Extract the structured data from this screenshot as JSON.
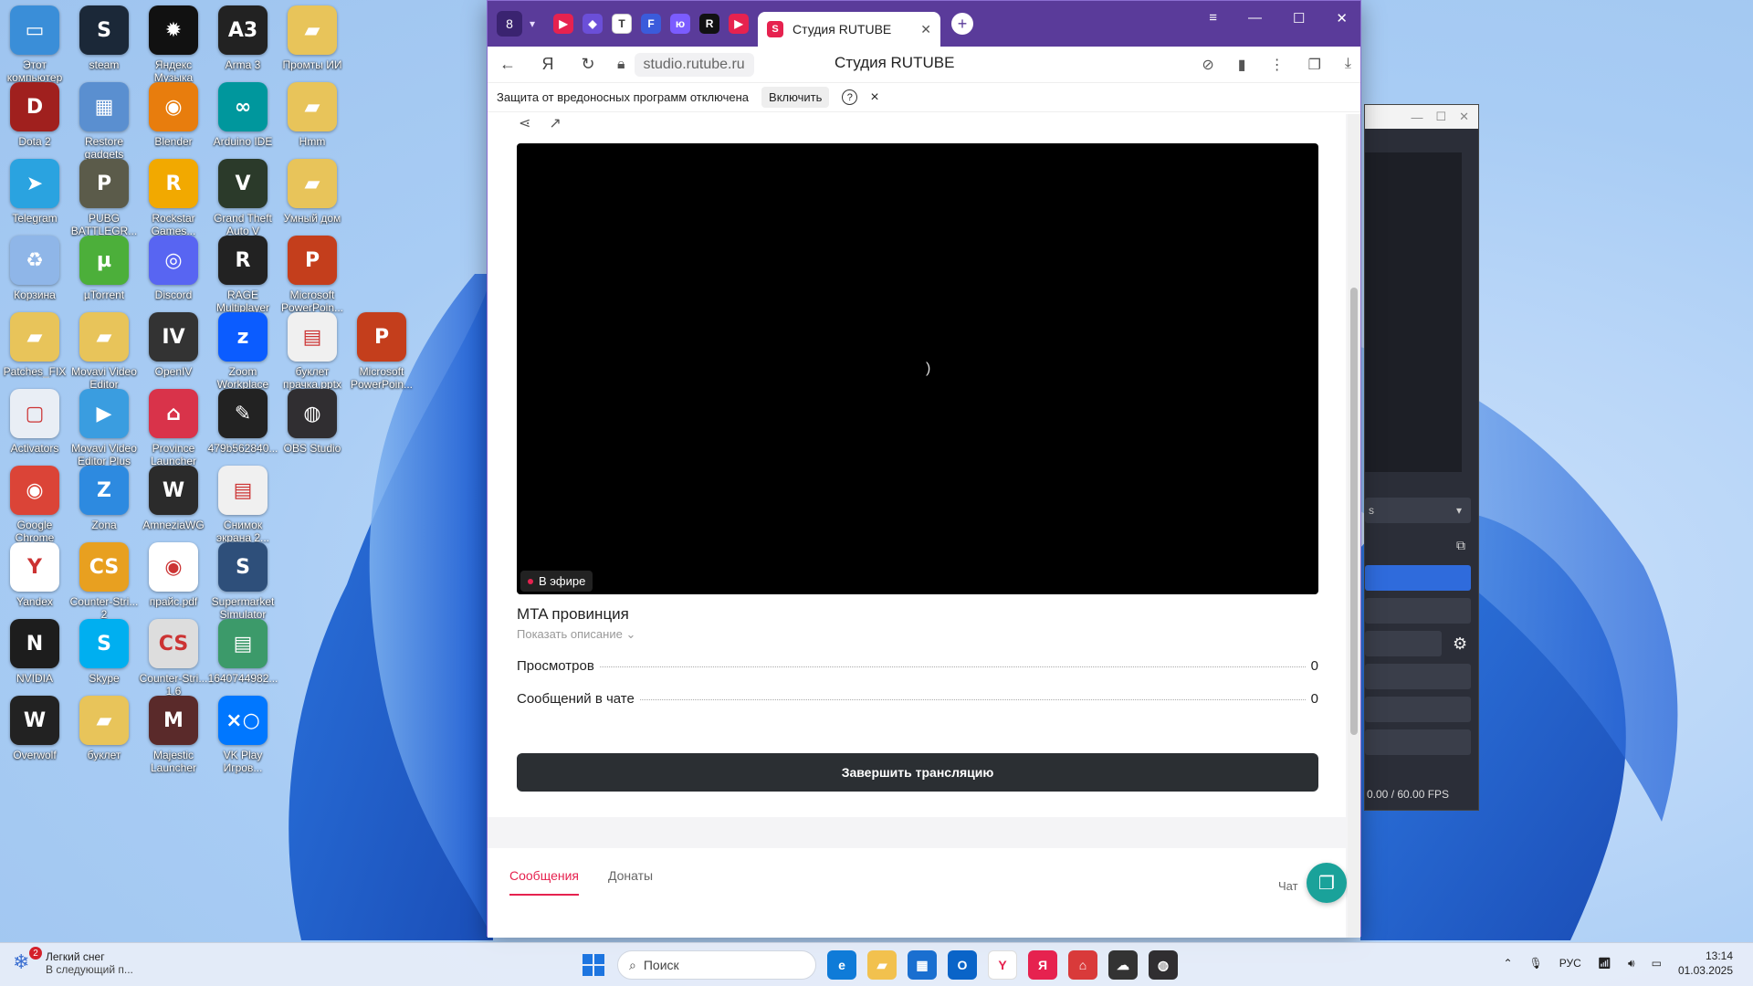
{
  "desktop": {
    "icons": [
      {
        "label": "Этот компьютер",
        "color": "#3a8ed8",
        "glyph": "▭"
      },
      {
        "label": "steam",
        "color": "#1b2838",
        "glyph": "S"
      },
      {
        "label": "Яндекс Музыка",
        "color": "#111111",
        "glyph": "✹"
      },
      {
        "label": "Arma 3",
        "color": "#222222",
        "glyph": "A3"
      },
      {
        "label": "Промты ИИ",
        "color": "#e8c45a",
        "glyph": "▰"
      },
      {
        "label": "Dota 2",
        "color": "#a0201e",
        "glyph": "D"
      },
      {
        "label": "Restore gadgets",
        "color": "#5a8fd0",
        "glyph": "▦"
      },
      {
        "label": "Blender",
        "color": "#e87d0d",
        "glyph": "◉"
      },
      {
        "label": "Arduino IDE",
        "color": "#00979d",
        "glyph": "∞"
      },
      {
        "label": "Hmm",
        "color": "#e8c45a",
        "glyph": "▰"
      },
      {
        "label": "Telegram",
        "color": "#2aa3e0",
        "glyph": "➤"
      },
      {
        "label": "PUBG BATTLEGR...",
        "color": "#5b5b4a",
        "glyph": "P"
      },
      {
        "label": "Rockstar Games...",
        "color": "#f2a900",
        "glyph": "R"
      },
      {
        "label": "Grand Theft Auto V",
        "color": "#2b3a2a",
        "glyph": "V"
      },
      {
        "label": "Умный дом",
        "color": "#e8c45a",
        "glyph": "▰"
      },
      {
        "label": "Корзина",
        "color": "#8fb6e8",
        "glyph": "♻"
      },
      {
        "label": "µTorrent",
        "color": "#4caf3a",
        "glyph": "µ"
      },
      {
        "label": "Discord",
        "color": "#5865f2",
        "glyph": "◎"
      },
      {
        "label": "RAGE Multiplayer",
        "color": "#222222",
        "glyph": "R"
      },
      {
        "label": "Microsoft PowerPoin...",
        "color": "#c43e1c",
        "glyph": "P"
      },
      {
        "label": "Patches_FIX",
        "color": "#e8c45a",
        "glyph": "▰"
      },
      {
        "label": "Movavi Video Editor",
        "color": "#e8c45a",
        "glyph": "▰"
      },
      {
        "label": "OpenIV",
        "color": "#333333",
        "glyph": "IV"
      },
      {
        "label": "Zoom Workplace",
        "color": "#0b5cff",
        "glyph": "z"
      },
      {
        "label": "буклет прачка.pptx",
        "color": "#f0f0f0",
        "glyph": "▤"
      },
      {
        "label": "Microsoft PowerPoin...",
        "color": "#c43e1c",
        "glyph": "P"
      },
      {
        "label": "Activators",
        "color": "#e9eef5",
        "glyph": "▢"
      },
      {
        "label": "Movavi Video Editor Plus",
        "color": "#3a9de0",
        "glyph": "▶"
      },
      {
        "label": "Province Launcher",
        "color": "#d9334a",
        "glyph": "⌂"
      },
      {
        "label": "479b562840...",
        "color": "#222222",
        "glyph": "✎"
      },
      {
        "label": "OBS Studio",
        "color": "#302e31",
        "glyph": "◍"
      },
      {
        "label": "Google Chrome",
        "color": "#db4437",
        "glyph": "◉"
      },
      {
        "label": "Zona",
        "color": "#2d8ae0",
        "glyph": "Z"
      },
      {
        "label": "AmneziaWG",
        "color": "#2b2b2b",
        "glyph": "W"
      },
      {
        "label": "Снимок экрана 2...",
        "color": "#f0f0f0",
        "glyph": "▤"
      },
      {
        "label": "Yandex",
        "color": "#ffffff",
        "glyph": "Y"
      },
      {
        "label": "Counter-Stri... 2",
        "color": "#e8a020",
        "glyph": "CS"
      },
      {
        "label": "прайс.pdf",
        "color": "#ffffff",
        "glyph": "◉"
      },
      {
        "label": "Supermarket Simulator",
        "color": "#2e4f7a",
        "glyph": "S"
      },
      {
        "label": "NVIDIA",
        "color": "#1d1d1d",
        "glyph": "N"
      },
      {
        "label": "Skype",
        "color": "#00aff0",
        "glyph": "S"
      },
      {
        "label": "Counter-Stri... 1.6",
        "color": "#dddddd",
        "glyph": "CS"
      },
      {
        "label": "1640744982...",
        "color": "#3c9a6a",
        "glyph": "▤"
      },
      {
        "label": "Overwolf",
        "color": "#222222",
        "glyph": "W"
      },
      {
        "label": "буклет",
        "color": "#e8c45a",
        "glyph": "▰"
      },
      {
        "label": "Majestic Launcher",
        "color": "#5a2a2a",
        "glyph": "M"
      },
      {
        "label": "VK Play Игров...",
        "color": "#0077ff",
        "glyph": "×○"
      }
    ]
  },
  "obs": {
    "select_text": "s",
    "fps_text": "0.00 / 60.00 FPS"
  },
  "browser": {
    "workspace_count": "8",
    "tab_title": "Студия RUTUBE",
    "url": "studio.rutube.ru",
    "page_title": "Студия RUTUBE",
    "warning_text": "Защита от вредоносных программ отключена",
    "enable_label": "Включить",
    "help_glyph": "?",
    "close_glyph": "×"
  },
  "stream": {
    "live_label": "В эфире",
    "title": "MTA провинция",
    "show_description": "Показать описание",
    "stats": [
      {
        "label": "Просмотров",
        "value": "0"
      },
      {
        "label": "Сообщений в чате",
        "value": "0"
      }
    ],
    "end_button": "Завершить трансляцию"
  },
  "chat": {
    "tabs": [
      "Сообщения",
      "Донаты"
    ],
    "selected_tab": "Сообщения",
    "chat_label": "Чат"
  },
  "taskbar": {
    "weather_badge": "2",
    "weather_line1": "Легкий снег",
    "weather_line2": "В следующий п...",
    "search_placeholder": "Поиск",
    "lang": "РУС",
    "time": "13:14",
    "date": "01.03.2025"
  },
  "colors": {
    "accent": "#e6224f",
    "browser_frame": "#5a3b9a",
    "end_button": "#2b2f33"
  }
}
